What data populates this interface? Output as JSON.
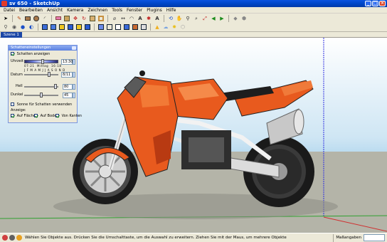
{
  "window": {
    "title": "sv 650 - SketchUp"
  },
  "menu": [
    "Datei",
    "Bearbeiten",
    "Ansicht",
    "Kamera",
    "Zeichnen",
    "Tools",
    "Fenster",
    "Plugins",
    "Hilfe"
  ],
  "scene_tab": "Szene 1",
  "shadow_panel": {
    "title": "Schatteneinstellungen",
    "show_shadows_label": "Schatten anzeigen",
    "time_label": "Uhrzeit",
    "time_value": "13:30",
    "time_start": "07:21",
    "time_mid": "Mittag",
    "time_end": "16:18",
    "months": "J F M A M J J A S O N D",
    "date_label": "Datum",
    "date_value": "8/11",
    "light_label": "Hell",
    "light_value": "80",
    "dark_label": "Dunkel",
    "dark_value": "45",
    "sun_shading_label": "Sonne für Schatten verwenden",
    "display_label": "Anzeige:",
    "on_faces_label": "Auf Flächen",
    "on_ground_label": "Auf Boden",
    "from_edges_label": "Von Kanten"
  },
  "status": {
    "text": "Wählen Sie Objekte aus. Drücken Sie die Umschalttaste, um die Auswahl zu erweitern. Ziehen Sie mit der Maus, um mehrere Objekte",
    "measurements_label": "Maßangaben"
  },
  "colors": {
    "accent": "#0a54e0",
    "body": "#e85a1e",
    "sky": "#cfe6f4",
    "ground": "#b4b4a8"
  },
  "icons": {
    "toolbar1": [
      "select-icon",
      "pencil-icon",
      "rectangle-icon",
      "circle-icon",
      "arc-icon",
      "eraser-icon",
      "push-pull-icon",
      "move-icon",
      "rotate-icon",
      "scale-icon",
      "offset-icon",
      "tape-icon",
      "dimension-icon",
      "protractor-icon",
      "text-icon",
      "axes-icon",
      "3d-text-icon",
      "orbit-icon",
      "pan-icon",
      "zoom-icon",
      "zoom-window-icon",
      "zoom-extents-icon",
      "previous-icon",
      "next-icon",
      "paint-icon",
      "component-icon"
    ],
    "toolbar2": [
      "walk-icon",
      "look-around-icon",
      "position-camera-icon",
      "section-icon",
      "iso-view-icon",
      "top-view-icon",
      "front-view-icon",
      "right-view-icon",
      "back-view-icon",
      "left-view-icon",
      "xray-icon",
      "wireframe-icon",
      "hidden-line-icon",
      "shaded-icon",
      "textured-icon",
      "monochrome-icon",
      "shadows-icon",
      "fog-icon",
      "sun-icon",
      "component-browser-icon"
    ]
  }
}
